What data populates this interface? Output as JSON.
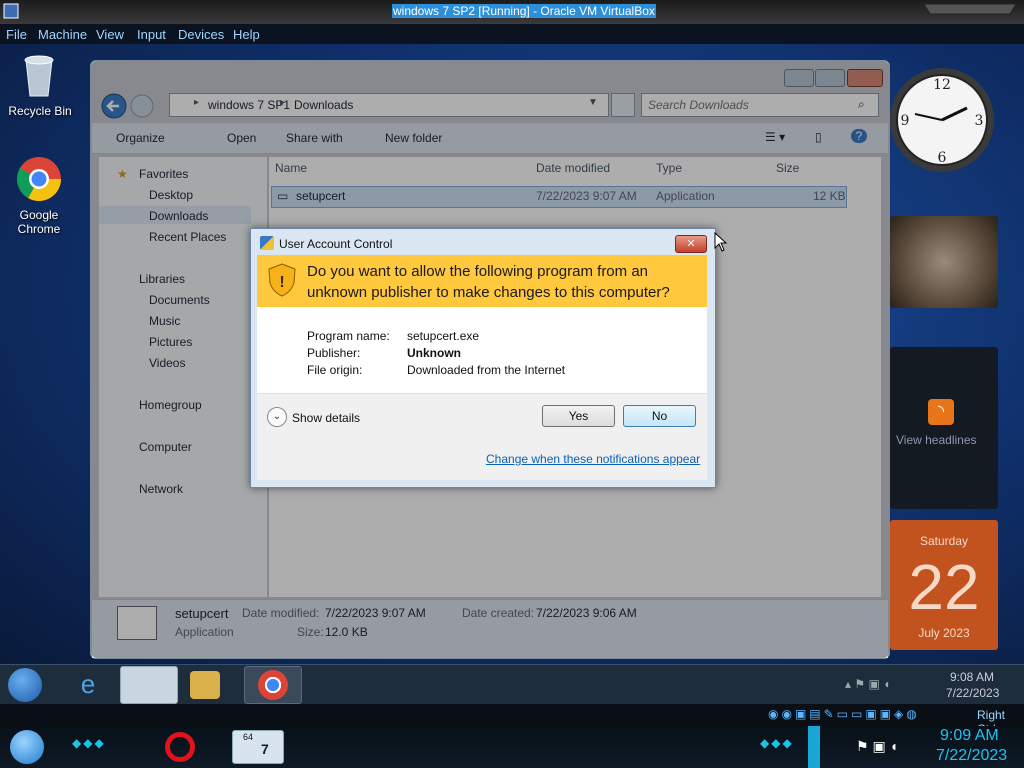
{
  "host": {
    "title": "windows 7 SP2 [Running] - Oracle VM VirtualBox",
    "menu": [
      "File",
      "Machine",
      "View",
      "Input",
      "Devices",
      "Help"
    ],
    "right_ctrl": "Right Ctrl",
    "clock_time": "9:09 AM",
    "clock_date": "7/22/2023",
    "badge_64": "64"
  },
  "desktop": {
    "icons": [
      {
        "label": "Recycle Bin"
      },
      {
        "label": "Google Chrome"
      }
    ]
  },
  "explorer": {
    "breadcrumb": [
      "windows 7 SP1",
      "Downloads"
    ],
    "search_placeholder": "Search Downloads",
    "toolbar": {
      "organize": "Organize",
      "open": "Open",
      "share": "Share with",
      "new_folder": "New folder"
    },
    "columns": {
      "name": "Name",
      "date": "Date modified",
      "type": "Type",
      "size": "Size"
    },
    "files": [
      {
        "name": "setupcert",
        "date": "7/22/2023 9:07 AM",
        "type": "Application",
        "size": "12 KB"
      }
    ],
    "nav": {
      "favorites": "Favorites",
      "fav_items": [
        "Desktop",
        "Downloads",
        "Recent Places"
      ],
      "libraries": "Libraries",
      "lib_items": [
        "Documents",
        "Music",
        "Pictures",
        "Videos"
      ],
      "homegroup": "Homegroup",
      "computer": "Computer",
      "network": "Network"
    },
    "details": {
      "name": "setupcert",
      "type": "Application",
      "date_modified_label": "Date modified:",
      "date_modified": "7/22/2023 9:07 AM",
      "date_created_label": "Date created:",
      "date_created": "7/22/2023 9:06 AM",
      "size_label": "Size:",
      "size": "12.0 KB"
    }
  },
  "uac": {
    "title": "User Account Control",
    "question_line1": "Do you want to allow the following program from an",
    "question_line2": "unknown publisher to make changes to this computer?",
    "program_name_label": "Program name:",
    "program_name": "setupcert.exe",
    "publisher_label": "Publisher:",
    "publisher": "Unknown",
    "origin_label": "File origin:",
    "origin": "Downloaded from the Internet",
    "show_details": "Show details",
    "yes": "Yes",
    "no": "No",
    "link": "Change when these notifications appear"
  },
  "gadgets": {
    "feed_text": "View headlines",
    "calendar_day": "Saturday",
    "calendar_date": "22",
    "calendar_month": "July 2023"
  },
  "guest_taskbar": {
    "time": "9:08 AM",
    "date": "7/22/2023"
  },
  "colors": {
    "uac_yellow": "#ffc83d",
    "link_blue": "#0b5fb5",
    "accent": "#2e8fd9"
  }
}
